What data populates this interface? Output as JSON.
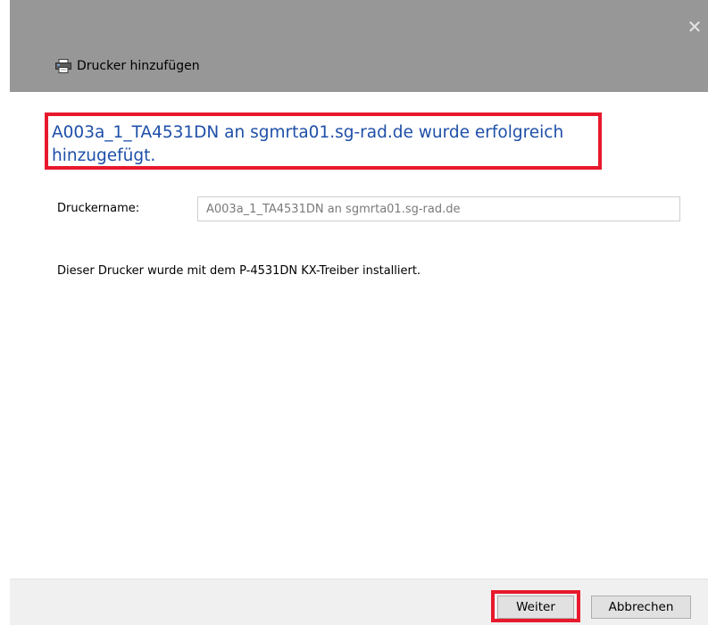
{
  "window": {
    "title": "Drucker hinzufügen",
    "title_icon": "printer-icon",
    "close_icon": "close-icon",
    "close_glyph": "✕"
  },
  "main": {
    "heading": "A003a_1_TA4531DN an sgmrta01.sg-rad.de wurde erfolgreich hinzugefügt.",
    "printer_name_label": "Druckername:",
    "printer_name_value": "A003a_1_TA4531DN an sgmrta01.sg-rad.de",
    "driver_info": "Dieser Drucker wurde mit dem P-4531DN KX-Treiber installiert."
  },
  "footer": {
    "next_label": "Weiter",
    "cancel_label": "Abbrechen"
  },
  "colors": {
    "titlebar": "#979797",
    "heading": "#1e4fa8",
    "highlight": "#e8192c"
  }
}
